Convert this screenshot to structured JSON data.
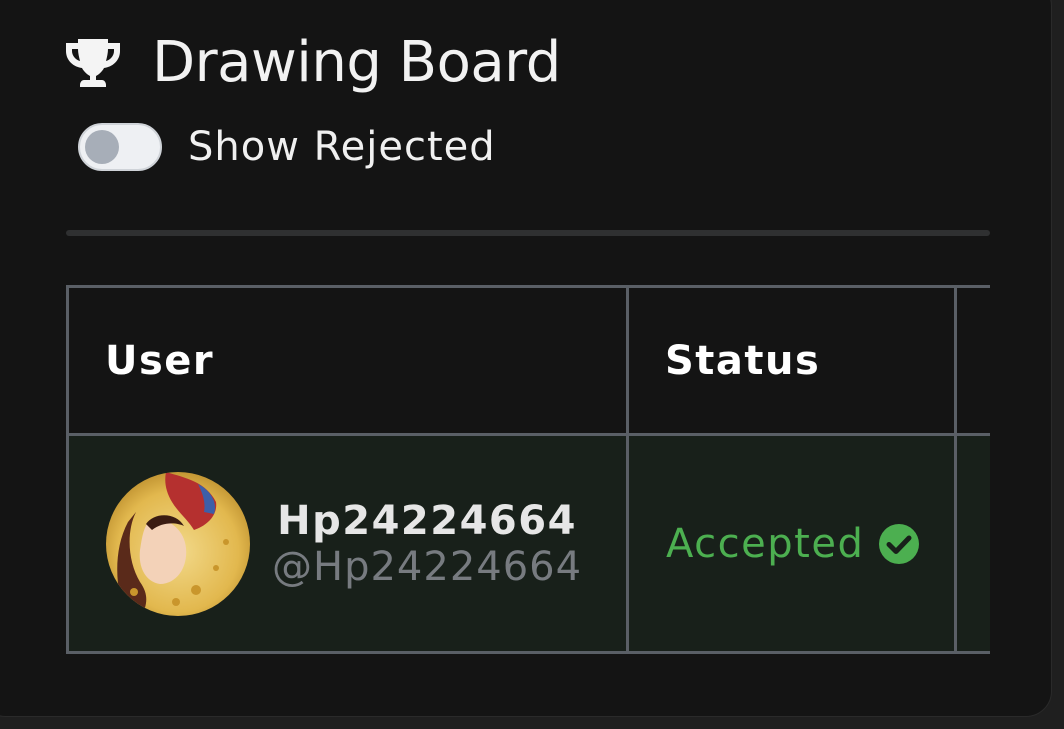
{
  "board": {
    "title": "Drawing Board",
    "title_icon": "trophy-icon"
  },
  "filters": {
    "show_rejected_label": "Show Rejected",
    "show_rejected_on": false
  },
  "table": {
    "columns": [
      "User",
      "Status",
      ""
    ],
    "rows": [
      {
        "user_name": "Hp24224664",
        "user_handle": "@Hp24224664",
        "status": "Accepted",
        "status_icon": "check-circle-icon"
      }
    ]
  },
  "colors": {
    "accent_green": "#4caf50",
    "row_background": "#18201a",
    "card_background": "#141414"
  }
}
